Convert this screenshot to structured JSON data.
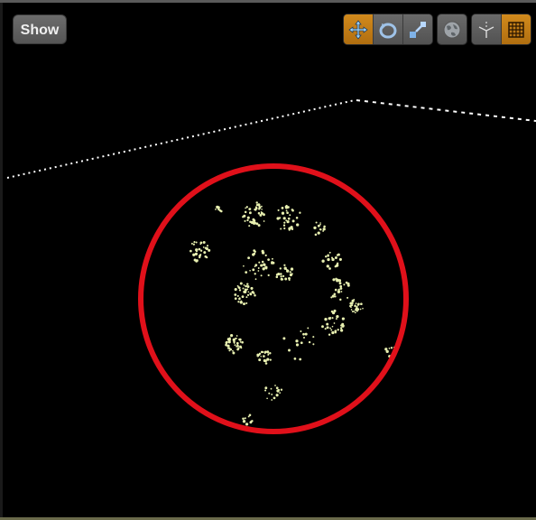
{
  "viewport": {
    "show_button_label": "Show",
    "toolbar": {
      "transform_group": [
        {
          "icon": "translate-arrows-icon",
          "active": true
        },
        {
          "icon": "rotate-icon",
          "active": false
        },
        {
          "icon": "scale-icon",
          "active": false
        }
      ],
      "world_local_icon": "globe-icon",
      "snap_group": [
        {
          "icon": "surface-snap-icon",
          "active": false
        },
        {
          "icon": "grid-snap-icon",
          "active": true
        }
      ]
    },
    "colors": {
      "background": "#000000",
      "highlight_circle": "#e0101a",
      "particles": "#e8f0b0",
      "bounds_line": "#ffffff",
      "active_button": "#c07a14"
    }
  }
}
